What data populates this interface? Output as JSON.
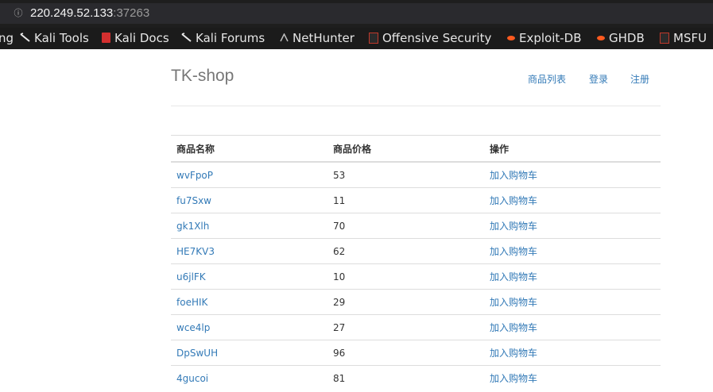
{
  "browser": {
    "url_host": "220.249.52.133",
    "url_port": ":37263",
    "bookmarks": [
      {
        "label": "ng",
        "icon": "none"
      },
      {
        "label": "Kali Tools",
        "icon": "kali-dragon-icon"
      },
      {
        "label": "Kali Docs",
        "icon": "kali-docs-icon"
      },
      {
        "label": "Kali Forums",
        "icon": "kali-dragon-icon"
      },
      {
        "label": "NetHunter",
        "icon": "nethunter-icon"
      },
      {
        "label": "Offensive Security",
        "icon": "offsec-icon"
      },
      {
        "label": "Exploit-DB",
        "icon": "exploit-db-icon"
      },
      {
        "label": "GHDB",
        "icon": "exploit-db-icon"
      },
      {
        "label": "MSFU",
        "icon": "offsec-icon"
      }
    ]
  },
  "navbar": {
    "brand": "TK-shop",
    "links": [
      "商品列表",
      "登录",
      "注册"
    ]
  },
  "table": {
    "headers": [
      "商品名称",
      "商品价格",
      "操作"
    ],
    "action_label": "加入购物车",
    "rows": [
      {
        "name": "wvFpoP",
        "price": "53"
      },
      {
        "name": "fu7Sxw",
        "price": "11"
      },
      {
        "name": "gk1Xlh",
        "price": "70"
      },
      {
        "name": "HE7KV3",
        "price": "62"
      },
      {
        "name": "u6jlFK",
        "price": "10"
      },
      {
        "name": "foeHIK",
        "price": "29"
      },
      {
        "name": "wce4lp",
        "price": "27"
      },
      {
        "name": "DpSwUH",
        "price": "96"
      },
      {
        "name": "4gucoi",
        "price": "81"
      }
    ]
  },
  "colors": {
    "link": "#337ab7",
    "brand_text": "#777777",
    "chrome_bg": "#1e1e1e"
  }
}
